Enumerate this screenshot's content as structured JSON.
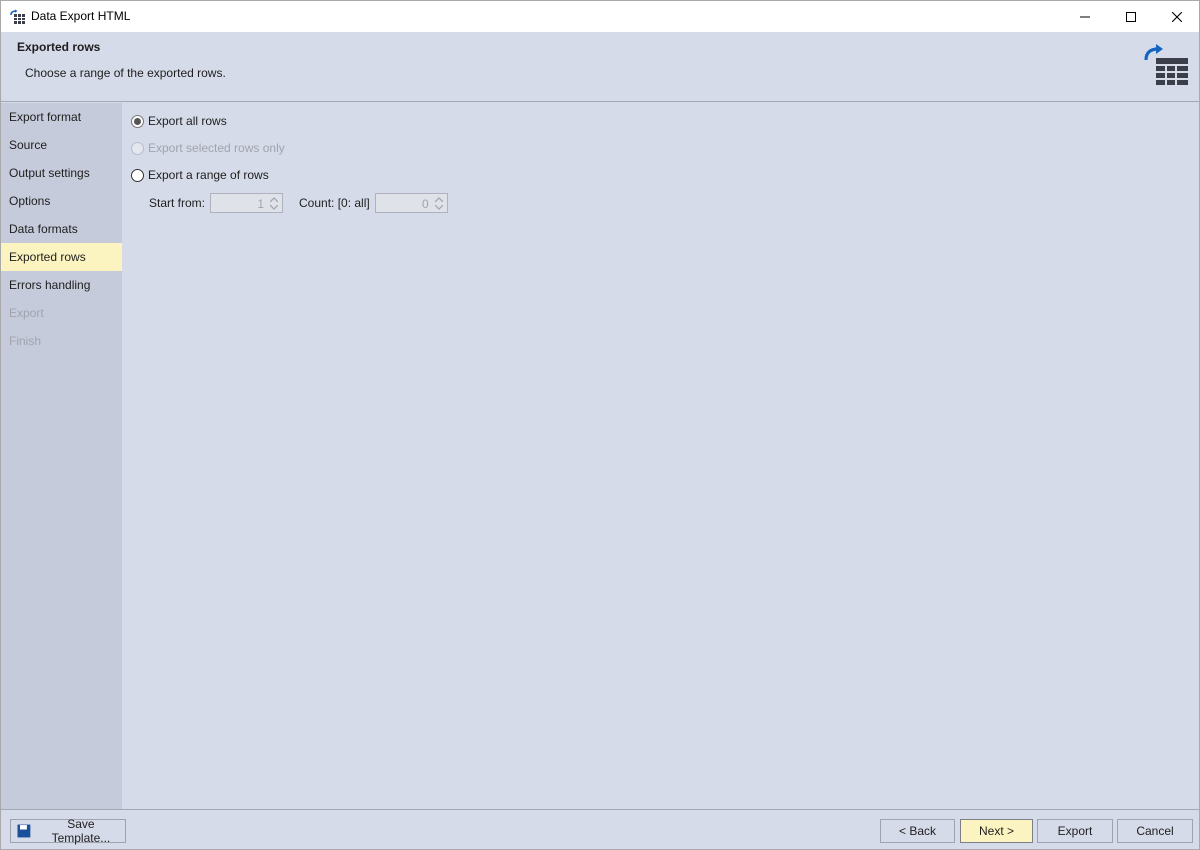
{
  "window": {
    "title": "Data Export HTML",
    "app_icon": "table-export-icon",
    "controls": {
      "minimize": "minimize-icon",
      "maximize": "maximize-icon",
      "close": "close-icon"
    }
  },
  "header": {
    "title": "Exported rows",
    "subtitle": "Choose a range of the exported rows.",
    "icon": "export-table-icon",
    "accent_color": "#1565c0"
  },
  "sidebar": {
    "items": [
      {
        "label": "Export format",
        "state": "normal"
      },
      {
        "label": "Source",
        "state": "normal"
      },
      {
        "label": "Output settings",
        "state": "normal"
      },
      {
        "label": "Options",
        "state": "normal"
      },
      {
        "label": "Data formats",
        "state": "normal"
      },
      {
        "label": "Exported rows",
        "state": "active"
      },
      {
        "label": "Errors handling",
        "state": "normal"
      },
      {
        "label": "Export",
        "state": "disabled"
      },
      {
        "label": "Finish",
        "state": "disabled"
      }
    ],
    "active_color": "#fcf4c0"
  },
  "options": {
    "export_all": {
      "label": "Export all rows",
      "checked": true,
      "enabled": true
    },
    "export_selected": {
      "label": "Export selected rows only",
      "checked": false,
      "enabled": false
    },
    "export_range": {
      "label": "Export a range of rows",
      "checked": false,
      "enabled": true
    }
  },
  "range": {
    "start_label": "Start from:",
    "start_value": "1",
    "count_label": "Count: [0: all]",
    "count_value": "0"
  },
  "footer": {
    "save_template": "Save Template...",
    "back": "< Back",
    "next": "Next >",
    "export": "Export",
    "cancel": "Cancel",
    "save_icon": "save-icon"
  }
}
